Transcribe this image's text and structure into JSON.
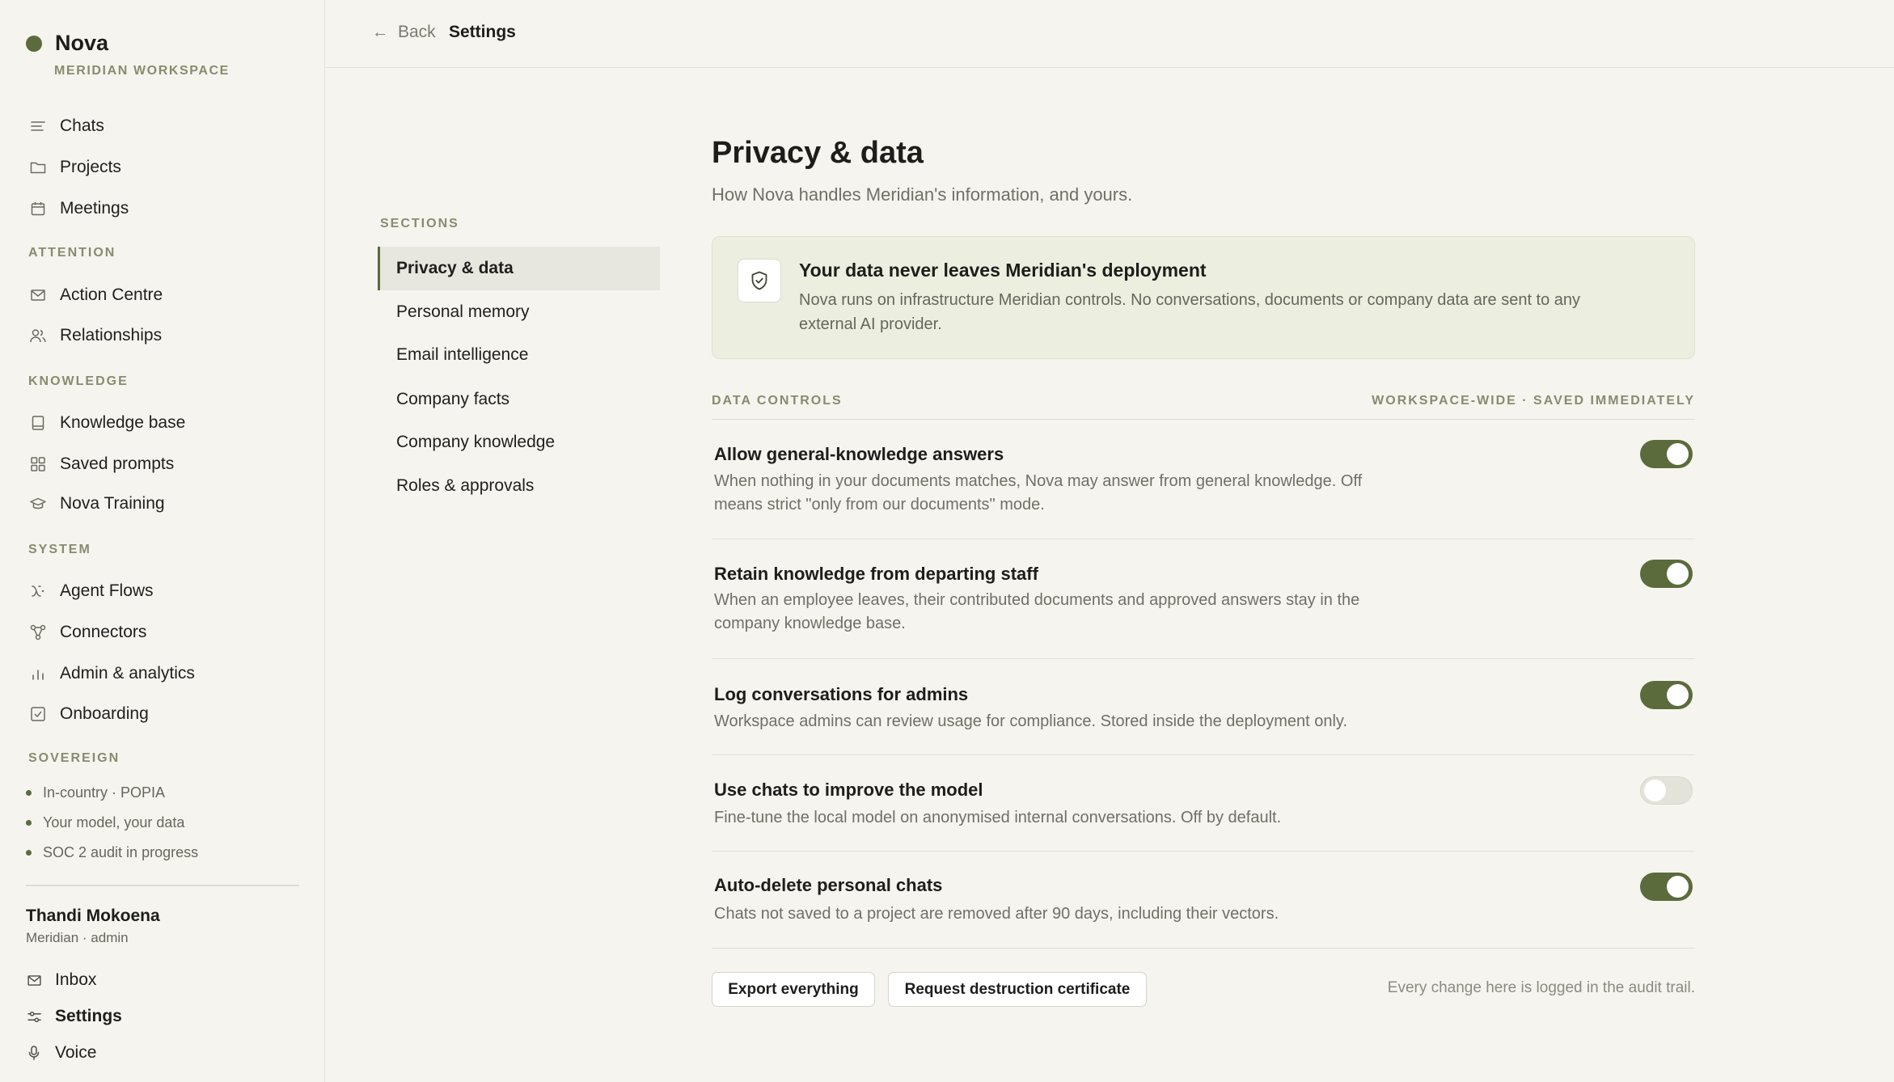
{
  "brand": {
    "name": "Nova",
    "workspace": "MERIDIAN WORKSPACE"
  },
  "sidebar": {
    "primary": [
      {
        "label": "Chats",
        "icon": "lines-icon"
      },
      {
        "label": "Projects",
        "icon": "folder-icon"
      },
      {
        "label": "Meetings",
        "icon": "calendar-icon"
      }
    ],
    "attention_label": "ATTENTION",
    "attention": [
      {
        "label": "Action Centre",
        "icon": "mail-icon"
      },
      {
        "label": "Relationships",
        "icon": "people-icon"
      }
    ],
    "knowledge_label": "KNOWLEDGE",
    "knowledge": [
      {
        "label": "Knowledge base",
        "icon": "book-icon"
      },
      {
        "label": "Saved prompts",
        "icon": "grid-icon"
      },
      {
        "label": "Nova Training",
        "icon": "graduation-cap-icon"
      }
    ],
    "system_label": "SYSTEM",
    "system": [
      {
        "label": "Agent Flows",
        "icon": "flow-icon"
      },
      {
        "label": "Connectors",
        "icon": "nodes-icon"
      },
      {
        "label": "Admin & analytics",
        "icon": "bar-chart-icon"
      },
      {
        "label": "Onboarding",
        "icon": "checkbox-icon"
      }
    ],
    "sovereign_label": "SOVEREIGN",
    "sovereign": [
      "In-country · POPIA",
      "Your model, your data",
      "SOC 2 audit in progress"
    ],
    "user": {
      "name": "Thandi Mokoena",
      "role": "Meridian · admin"
    },
    "footer": [
      {
        "label": "Inbox",
        "icon": "mail-icon"
      },
      {
        "label": "Settings",
        "icon": "sliders-icon"
      },
      {
        "label": "Voice",
        "icon": "mic-icon"
      }
    ]
  },
  "topbar": {
    "back_label": "Back",
    "title": "Settings"
  },
  "sections": {
    "label": "SECTIONS",
    "items": [
      "Privacy & data",
      "Personal memory",
      "Email intelligence",
      "Company facts",
      "Company knowledge",
      "Roles & approvals"
    ],
    "active": "Privacy & data"
  },
  "main": {
    "title": "Privacy & data",
    "subtitle": "How Nova handles Meridian's information, and yours.",
    "notice": {
      "icon": "shield-check-icon",
      "title": "Your data never leaves Meridian's deployment",
      "text": "Nova runs on infrastructure Meridian controls. No conversations, documents or company data are sent to any external AI provider."
    },
    "controls_label": "DATA CONTROLS",
    "controls_scope": "WORKSPACE-WIDE · SAVED IMMEDIATELY",
    "controls": [
      {
        "title": "Allow general-knowledge answers",
        "desc": "When nothing in your documents matches, Nova may answer from general knowledge. Off means strict \"only from our documents\" mode.",
        "on": true
      },
      {
        "title": "Retain knowledge from departing staff",
        "desc": "When an employee leaves, their contributed documents and approved answers stay in the company knowledge base.",
        "on": true
      },
      {
        "title": "Log conversations for admins",
        "desc": "Workspace admins can review usage for compliance. Stored inside the deployment only.",
        "on": true
      },
      {
        "title": "Use chats to improve the model",
        "desc": "Fine-tune the local model on anonymised internal conversations. Off by default.",
        "on": false
      },
      {
        "title": "Auto-delete personal chats",
        "desc": "Chats not saved to a project are removed after 90 days, including their vectors.",
        "on": true
      }
    ],
    "export_label": "Export everything",
    "destruction_label": "Request destruction certificate",
    "audit_note": "Every change here is logged in the audit trail."
  },
  "colors": {
    "accent": "#5b6b3c",
    "background": "#f5f4ef",
    "notice_bg": "#eceee0"
  }
}
